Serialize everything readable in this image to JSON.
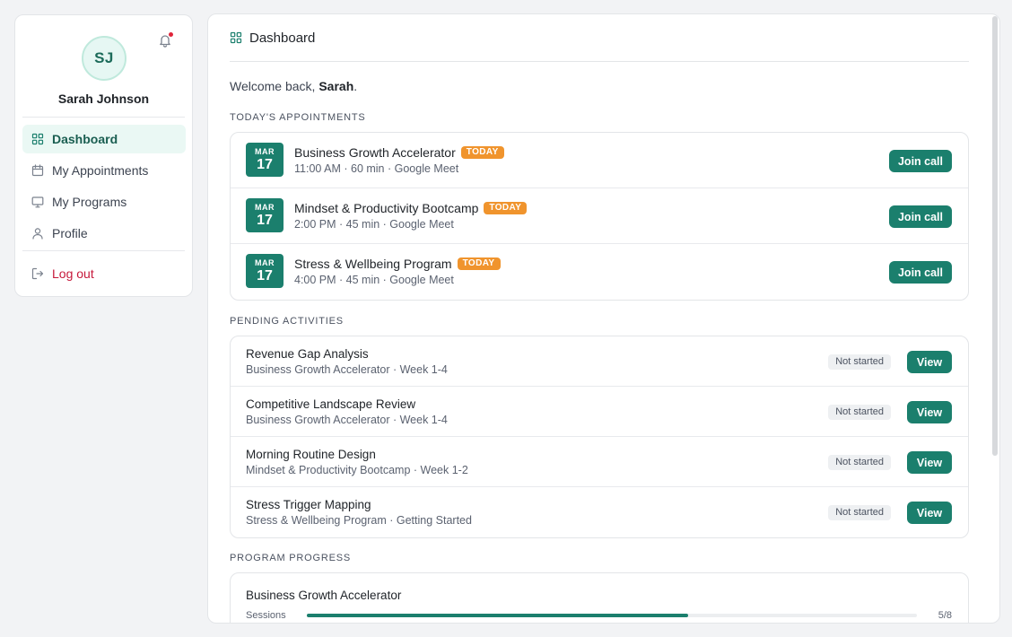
{
  "user": {
    "initials": "SJ",
    "name": "Sarah Johnson"
  },
  "nav": [
    {
      "label": "Dashboard",
      "icon": "grid-icon",
      "active": true
    },
    {
      "label": "My Appointments",
      "icon": "calendar-icon"
    },
    {
      "label": "My Programs",
      "icon": "monitor-icon"
    },
    {
      "label": "Profile",
      "icon": "user-icon"
    }
  ],
  "logout_label": "Log out",
  "header": {
    "title": "Dashboard"
  },
  "welcome": {
    "prefix": "Welcome back, ",
    "name": "Sarah",
    "suffix": "."
  },
  "sections": {
    "appointments": "TODAY'S APPOINTMENTS",
    "activities": "PENDING ACTIVITIES",
    "progress": "PROGRAM PROGRESS"
  },
  "appointments": [
    {
      "month": "MAR",
      "day": "17",
      "title": "Business Growth Accelerator",
      "badge": "TODAY",
      "sub": "11:00 AM · 60 min · Google Meet",
      "action": "Join call"
    },
    {
      "month": "MAR",
      "day": "17",
      "title": "Mindset & Productivity Bootcamp",
      "badge": "TODAY",
      "sub": "2:00 PM · 45 min · Google Meet",
      "action": "Join call"
    },
    {
      "month": "MAR",
      "day": "17",
      "title": "Stress & Wellbeing Program",
      "badge": "TODAY",
      "sub": "4:00 PM · 45 min · Google Meet",
      "action": "Join call"
    }
  ],
  "activities": [
    {
      "title": "Revenue Gap Analysis",
      "sub": "Business Growth Accelerator · Week 1-4",
      "status": "Not started",
      "action": "View"
    },
    {
      "title": "Competitive Landscape Review",
      "sub": "Business Growth Accelerator · Week 1-4",
      "status": "Not started",
      "action": "View"
    },
    {
      "title": "Morning Routine Design",
      "sub": "Mindset & Productivity Bootcamp · Week 1-2",
      "status": "Not started",
      "action": "View"
    },
    {
      "title": "Stress Trigger Mapping",
      "sub": "Stress & Wellbeing Program · Getting Started",
      "status": "Not started",
      "action": "View"
    }
  ],
  "progress": [
    {
      "name": "Business Growth Accelerator",
      "label": "Sessions",
      "completed": 5,
      "total": 8,
      "count": "5/8"
    }
  ],
  "colors": {
    "accent": "#1b7f6d",
    "today_badge": "#f0942d",
    "logout": "#c6183a",
    "notification_dot": "#e0243a"
  }
}
